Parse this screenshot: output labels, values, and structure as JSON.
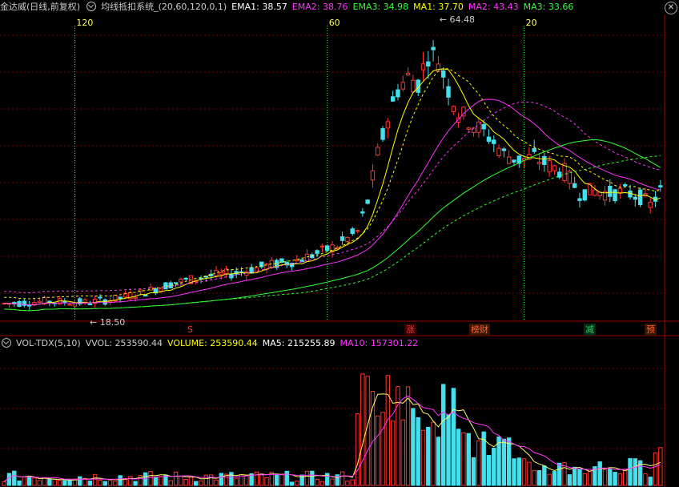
{
  "main_header": {
    "stock_title": "金达威(日线,前复权)",
    "indicator_name": "均线抵扣系统_(20,60,120,0,1)",
    "values": [
      {
        "label": "EMA1: 38.57",
        "color": "#ffffff"
      },
      {
        "label": "EMA2: 38.76",
        "color": "#ff33ff"
      },
      {
        "label": "EMA3: 34.98",
        "color": "#33ff33"
      },
      {
        "label": "MA1: 37.70",
        "color": "#ffff00"
      },
      {
        "label": "MA2: 43.43",
        "color": "#ff33ff"
      },
      {
        "label": "MA3: 33.66",
        "color": "#33ff33"
      }
    ]
  },
  "vol_header": {
    "indicator_name": "VOL-TDX(5,10)",
    "values": [
      {
        "label": "VVOL: 253590.44",
        "color": "#cccccc"
      },
      {
        "label": "VOLUME: 253590.44",
        "color": "#ffff00"
      },
      {
        "label": "MA5: 215255.89",
        "color": "#ffffff"
      },
      {
        "label": "MA10: 157301.22",
        "color": "#ff33ff"
      }
    ]
  },
  "markers": {
    "deduct_120": "120",
    "deduct_60": "60",
    "deduct_20": "20",
    "high_price": "64.48",
    "low_price": "18.50"
  },
  "signals": [
    {
      "label": "S",
      "color": "#ff3333"
    },
    {
      "label": "涨",
      "color": "#ff3333"
    },
    {
      "label": "榜财",
      "color": "#ff6633"
    },
    {
      "label": "减",
      "color": "#33cc66"
    },
    {
      "label": "预",
      "color": "#ff6633"
    }
  ],
  "colors": {
    "up": "#ff3333",
    "down": "#44e0ee",
    "grid": "#7a0000",
    "ma_short": "#ffff00",
    "ma_mid": "#ff33ff",
    "ma_long": "#33ff33"
  },
  "icons": {
    "indicator_toggle": "settings-circle-icon",
    "close": "close-icon"
  }
}
